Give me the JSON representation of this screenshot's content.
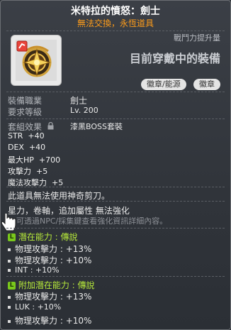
{
  "item": {
    "name": "米特拉的憤怒：劍士",
    "note": "無法交換，永恆道具",
    "power_label": "戰鬥力提升量",
    "equipped_text": "目前穿戴中的裝備",
    "badges": [
      "徽章/能源",
      "徽章"
    ]
  },
  "info": {
    "job_label": "裝備職業",
    "job_value": "劍士",
    "level_label": "要求等級",
    "level_value": "Lv. 200",
    "set_label": "套組效果",
    "set_value": "漆黑BOSS套裝"
  },
  "stats": [
    {
      "name": "STR",
      "value": "+40"
    },
    {
      "name": "DEX",
      "value": "+40"
    },
    {
      "name": "最大HP",
      "value": "+700"
    },
    {
      "name": "攻擊力",
      "value": "+5"
    },
    {
      "name": "魔法攻擊力",
      "value": "+5"
    }
  ],
  "notes": {
    "line1": "此道具無法使用神奇剪刀。",
    "line2": "星力，卷軸，追加屬性 無法強化",
    "line3": "可透過NPC/採集鍵查看強化資訊詳細內容。"
  },
  "potential": {
    "tag": "L",
    "title": "潛在能力 : 傳說",
    "lines": [
      {
        "name": "物理攻擊力",
        "value": "+13%"
      },
      {
        "name": "物理攻擊力",
        "value": "+10%"
      },
      {
        "name": "INT",
        "value": "+10%"
      }
    ]
  },
  "additional": {
    "tag": "L",
    "title": "附加潛在能力 : 傳說",
    "lines": [
      {
        "name": "物理攻擊力",
        "value": "+13%"
      },
      {
        "name": "LUK",
        "value": "+10%"
      },
      {
        "name": "物理攻擊力",
        "value": "+10%"
      }
    ]
  },
  "colors": {
    "title": "#ffffff",
    "note": "#ff9d1a",
    "potential": "#b7ea3a",
    "background": "#33373d"
  },
  "icons": {
    "item": "emblem-icon",
    "lock": "lock-icon",
    "cursor": "hand-cursor-icon"
  }
}
